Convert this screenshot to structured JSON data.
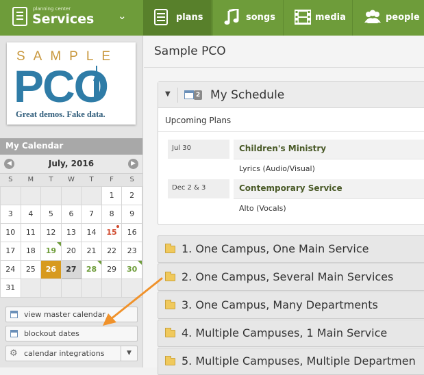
{
  "brand": {
    "small": "planning center",
    "name": "Services"
  },
  "nav": [
    {
      "label": "plans",
      "icon": "plans-icon"
    },
    {
      "label": "songs",
      "icon": "music-note-icon"
    },
    {
      "label": "media",
      "icon": "film-icon"
    },
    {
      "label": "people",
      "icon": "people-icon"
    }
  ],
  "logo": {
    "top": "SAMPLE",
    "main": "PCO",
    "tagline": "Great demos. Fake data."
  },
  "calendar": {
    "header": "My Calendar",
    "month": "July, 2016",
    "weekdays": [
      "S",
      "M",
      "T",
      "W",
      "T",
      "F",
      "S"
    ],
    "weeks": [
      [
        "",
        "",
        "",
        "",
        "",
        "1",
        "2"
      ],
      [
        "3",
        "4",
        "5",
        "6",
        "7",
        "8",
        "9"
      ],
      [
        "10",
        "11",
        "12",
        "13",
        "14",
        "15",
        "16"
      ],
      [
        "17",
        "18",
        "19",
        "20",
        "21",
        "22",
        "23"
      ],
      [
        "24",
        "25",
        "26",
        "27",
        "28",
        "29",
        "30"
      ],
      [
        "31",
        "",
        "",
        "",
        "",
        "",
        ""
      ]
    ],
    "green_days": [
      "19",
      "28",
      "30"
    ],
    "red_days": [
      "15"
    ],
    "today": "26",
    "selected": "27"
  },
  "sidebar_buttons": {
    "master": "view master calendar",
    "blockout": "blockout dates",
    "integrations": "calendar integrations"
  },
  "main": {
    "title": "Sample PCO",
    "schedule": {
      "title": "My Schedule",
      "badge": "2",
      "upcoming_label": "Upcoming Plans",
      "plans": [
        {
          "date": "Jul 30",
          "name": "Children's Ministry",
          "role": "Lyrics (Audio/Visual)"
        },
        {
          "date": "Dec 2 & 3",
          "name": "Contemporary Service",
          "role": "Alto (Vocals)"
        }
      ]
    },
    "folders": [
      "1. One Campus, One Main Service",
      "2. One Campus, Several Main Services",
      "3. One Campus, Many Departments",
      "4. Multiple Campuses, 1 Main Service",
      "5. Multiple Campuses, Multiple Departmen"
    ]
  },
  "colors": {
    "brand_green": "#6e9c3a",
    "active_tab": "#58802b",
    "today": "#d79a1f",
    "annotation_arrow": "#f0922b"
  }
}
